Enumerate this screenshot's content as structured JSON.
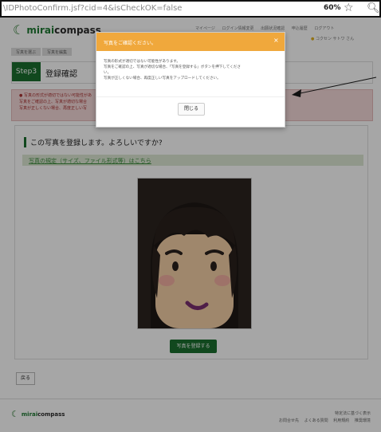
{
  "browser": {
    "url": "\\IDPhotoConfirm.jsf?cid=4&isCheckOK=false",
    "zoom": "60%",
    "icons": {
      "star": "star-icon",
      "search": "search-icon"
    }
  },
  "header": {
    "brand_bold": "mirai",
    "brand_rest": "compass",
    "links": [
      "マイページ",
      "ログイン情報変更",
      "出願状況確認",
      "申込履歴",
      "ログアウト"
    ],
    "user": "コクセン サトワ さん"
  },
  "breadcrumbs": [
    "写真を選ぶ",
    "写真を編集"
  ],
  "step": {
    "tag": "Step3",
    "title": "登録確認"
  },
  "error": {
    "lines": [
      "● 写真の形式が適切ではない可能性があ",
      "写真をご確認の上、写真が適切な場合",
      "写真が正しくない場合、再度正しい写"
    ]
  },
  "panel": {
    "title": "この写真を登録します。よろしいですか?",
    "info_link": "写真の規定（サイズ、ファイル形式等）はこちら",
    "register_button": "写真を登録する"
  },
  "back_button": "戻る",
  "footer": {
    "brand_bold": "mirai",
    "brand_rest": "compass",
    "link_top": "特定法に基づく表示",
    "links": [
      "お問合せ先",
      "よくある質問",
      "利用規約",
      "推奨環境"
    ]
  },
  "modal": {
    "title": "写真をご確認ください。",
    "close_symbol": "×",
    "lines": [
      "写真の形式が適切ではない可能性があります。",
      "写真をご確認の上、写真が適切な場合、「写真を登録する」ボタンを押下してくださ",
      "い。",
      "写真が正しくない場合、再度正しい写真をアップロードしてください。"
    ],
    "close_button": "閉じる"
  },
  "colors": {
    "accent": "#1b6f2f",
    "modal_header": "#f0a83c",
    "error_bg": "#f4d9d9"
  }
}
